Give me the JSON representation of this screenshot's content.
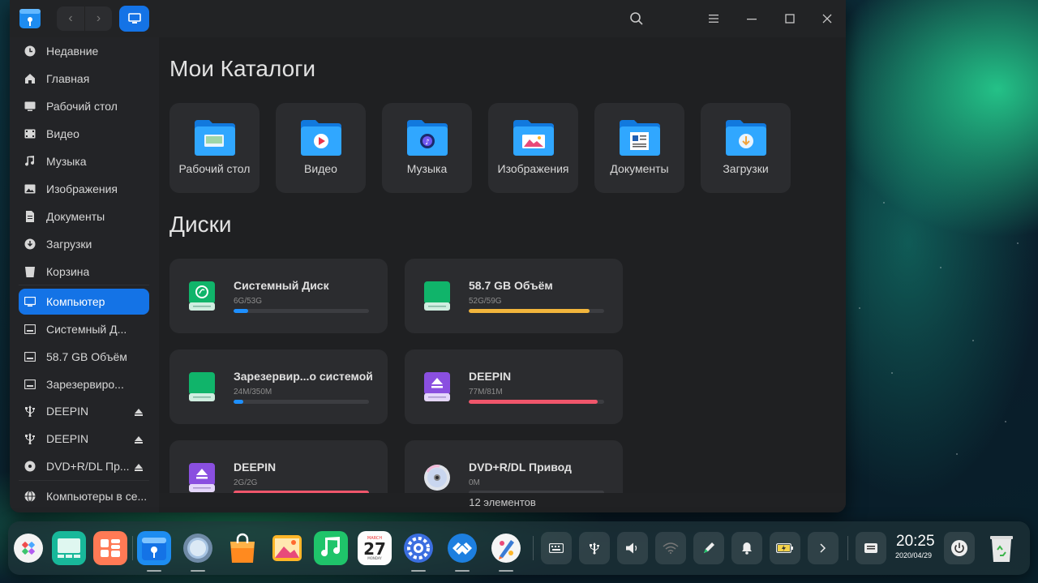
{
  "window": {
    "sidebar": {
      "items": [
        {
          "label": "Недавние",
          "icon": "clock-icon"
        },
        {
          "label": "Главная",
          "icon": "home-icon"
        },
        {
          "label": "Рабочий стол",
          "icon": "desktop-icon"
        },
        {
          "label": "Видео",
          "icon": "video-icon"
        },
        {
          "label": "Музыка",
          "icon": "music-icon"
        },
        {
          "label": "Изображения",
          "icon": "image-icon"
        },
        {
          "label": "Документы",
          "icon": "document-icon"
        },
        {
          "label": "Загрузки",
          "icon": "download-icon"
        },
        {
          "label": "Корзина",
          "icon": "trash-icon"
        },
        {
          "label": "Компьютер",
          "icon": "computer-icon",
          "active": true
        },
        {
          "label": "Системный Д...",
          "icon": "disk-icon"
        },
        {
          "label": "58.7 GB Объём",
          "icon": "disk-icon"
        },
        {
          "label": "Зарезервиро...",
          "icon": "disk-icon"
        },
        {
          "label": "DEEPIN",
          "icon": "usb-icon",
          "eject": true
        },
        {
          "label": "DEEPIN",
          "icon": "usb-icon",
          "eject": true
        },
        {
          "label": "DVD+R/DL Пр...",
          "icon": "optical-disc-icon",
          "eject": true
        },
        {
          "label": "Компьютеры в се...",
          "icon": "network-icon"
        }
      ]
    },
    "main": {
      "catalogs_title": "Мои Каталоги",
      "catalogs": [
        {
          "label": "Рабочий стол",
          "icon": "desktop-folder-icon"
        },
        {
          "label": "Видео",
          "icon": "video-folder-icon"
        },
        {
          "label": "Музыка",
          "icon": "music-folder-icon"
        },
        {
          "label": "Изображения",
          "icon": "images-folder-icon"
        },
        {
          "label": "Документы",
          "icon": "documents-folder-icon"
        },
        {
          "label": "Загрузки",
          "icon": "downloads-folder-icon"
        }
      ],
      "disks_title": "Диски",
      "disks": [
        {
          "name": "Системный Диск",
          "size": "6G/53G",
          "usage": 0.11,
          "color": "#1e90ff",
          "icon": "system-disk-icon"
        },
        {
          "name": "58.7 GB Объём",
          "size": "52G/59G",
          "usage": 0.89,
          "color": "#f2b53c",
          "icon": "disk-icon"
        },
        {
          "name": "Зарезервир...о системой",
          "size": "24M/350M",
          "usage": 0.07,
          "color": "#1e90ff",
          "icon": "disk-icon"
        },
        {
          "name": "DEEPIN",
          "size": "77M/81M",
          "usage": 0.95,
          "color": "#f0566b",
          "icon": "usb-drive-icon"
        },
        {
          "name": "DEEPIN",
          "size": "2G/2G",
          "usage": 1.0,
          "color": "#f0566b",
          "icon": "usb-drive-icon"
        },
        {
          "name": "DVD+R/DL Привод",
          "size": "0M",
          "usage": 0,
          "color": "#3c3d41",
          "icon": "dvd-icon"
        }
      ],
      "status": "12 элементов"
    }
  },
  "dock": {
    "clock_time": "20:25",
    "clock_date": "2020/04/29",
    "calendar_month": "MARCH",
    "calendar_day": "27",
    "calendar_weekday": "MONDAY"
  }
}
